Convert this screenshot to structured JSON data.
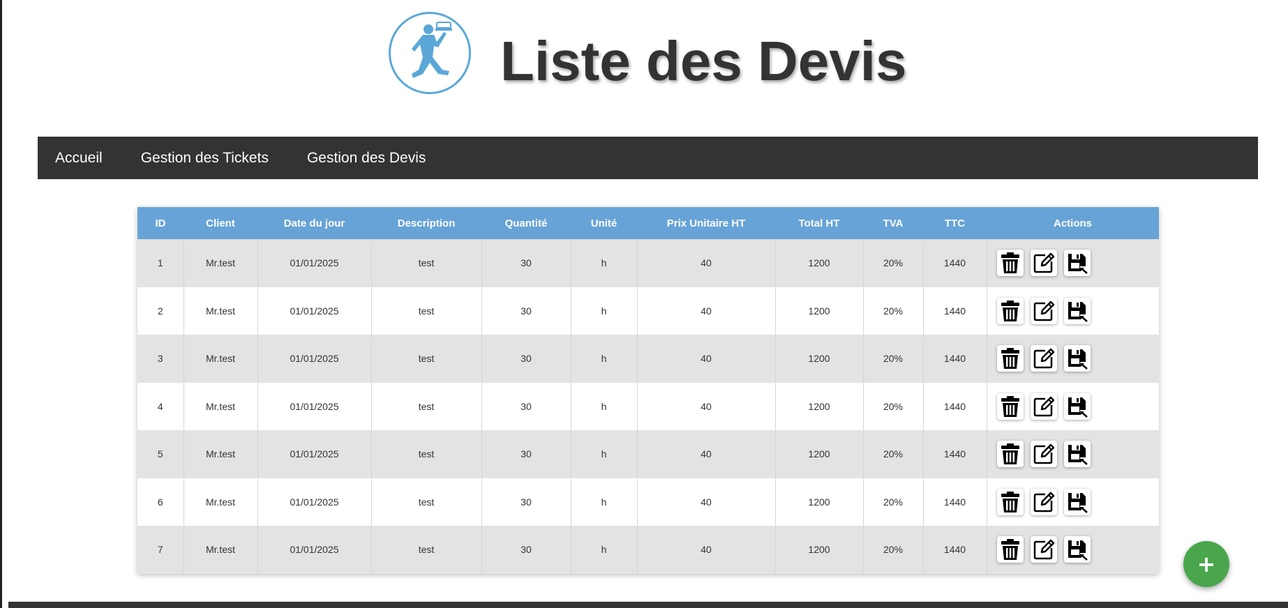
{
  "page": {
    "title": "Liste des Devis"
  },
  "nav": {
    "items": [
      {
        "label": "Accueil"
      },
      {
        "label": "Gestion des Tickets"
      },
      {
        "label": "Gestion des Devis"
      }
    ]
  },
  "table": {
    "headers": [
      "ID",
      "Client",
      "Date du jour",
      "Description",
      "Quantité",
      "Unité",
      "Prix Unitaire HT",
      "Total HT",
      "TVA",
      "TTC",
      "Actions"
    ],
    "rows": [
      {
        "id": "1",
        "client": "Mr.test",
        "date": "01/01/2025",
        "description": "test",
        "quantite": "30",
        "unite": "h",
        "prix": "40",
        "total_ht": "1200",
        "tva": "20%",
        "ttc": "1440"
      },
      {
        "id": "2",
        "client": "Mr.test",
        "date": "01/01/2025",
        "description": "test",
        "quantite": "30",
        "unite": "h",
        "prix": "40",
        "total_ht": "1200",
        "tva": "20%",
        "ttc": "1440"
      },
      {
        "id": "3",
        "client": "Mr.test",
        "date": "01/01/2025",
        "description": "test",
        "quantite": "30",
        "unite": "h",
        "prix": "40",
        "total_ht": "1200",
        "tva": "20%",
        "ttc": "1440"
      },
      {
        "id": "4",
        "client": "Mr.test",
        "date": "01/01/2025",
        "description": "test",
        "quantite": "30",
        "unite": "h",
        "prix": "40",
        "total_ht": "1200",
        "tva": "20%",
        "ttc": "1440"
      },
      {
        "id": "5",
        "client": "Mr.test",
        "date": "01/01/2025",
        "description": "test",
        "quantite": "30",
        "unite": "h",
        "prix": "40",
        "total_ht": "1200",
        "tva": "20%",
        "ttc": "1440"
      },
      {
        "id": "6",
        "client": "Mr.test",
        "date": "01/01/2025",
        "description": "test",
        "quantite": "30",
        "unite": "h",
        "prix": "40",
        "total_ht": "1200",
        "tva": "20%",
        "ttc": "1440"
      },
      {
        "id": "7",
        "client": "Mr.test",
        "date": "01/01/2025",
        "description": "test",
        "quantite": "30",
        "unite": "h",
        "prix": "40",
        "total_ht": "1200",
        "tva": "20%",
        "ttc": "1440"
      }
    ],
    "row_actions": [
      "trash-icon",
      "edit-icon",
      "save-icon"
    ]
  },
  "fab": {
    "label": "+"
  },
  "colors": {
    "header_blue": "#67a3d6",
    "navbar": "#333333",
    "fab_green": "#4aa64d",
    "logo_blue": "#5aa7d8"
  }
}
